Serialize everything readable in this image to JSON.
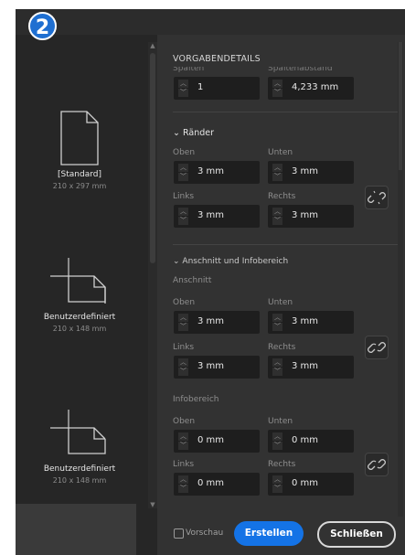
{
  "step_badge": "2",
  "presets": [
    {
      "name": "[Standard]",
      "dims": "210 x 297 mm"
    },
    {
      "name": "Benutzerdefiniert",
      "dims": "210 x 148 mm"
    },
    {
      "name": "Benutzerdefiniert",
      "dims": "210 x 148 mm"
    }
  ],
  "section_title": "VORGABENDETAILS",
  "columns": {
    "label_left": "Spalten",
    "label_right": "Spaltenabstand",
    "value_left": "1",
    "value_right": "4,233 mm"
  },
  "margins": {
    "heading": "Ränder",
    "top_label": "Oben",
    "top": "3 mm",
    "bottom_label": "Unten",
    "bottom": "3 mm",
    "left_label": "Links",
    "left": "3 mm",
    "right_label": "Rechts",
    "right": "3 mm"
  },
  "bleed_slug": {
    "heading": "Anschnitt und Infobereich",
    "bleed": {
      "label": "Anschnitt",
      "top_label": "Oben",
      "top": "3 mm",
      "bottom_label": "Unten",
      "bottom": "3 mm",
      "left_label": "Links",
      "left": "3 mm",
      "right_label": "Rechts",
      "right": "3 mm"
    },
    "slug": {
      "label": "Infobereich",
      "top_label": "Oben",
      "top": "0 mm",
      "bottom_label": "Unten",
      "bottom": "0 mm",
      "left_label": "Links",
      "left": "0 mm",
      "right_label": "Rechts",
      "right": "0 mm"
    }
  },
  "footer": {
    "preview_label": "Vorschau",
    "create_label": "Erstellen",
    "close_label": "Schließen"
  },
  "colors": {
    "accent": "#1473e6",
    "badge": "#1f6fd1"
  }
}
